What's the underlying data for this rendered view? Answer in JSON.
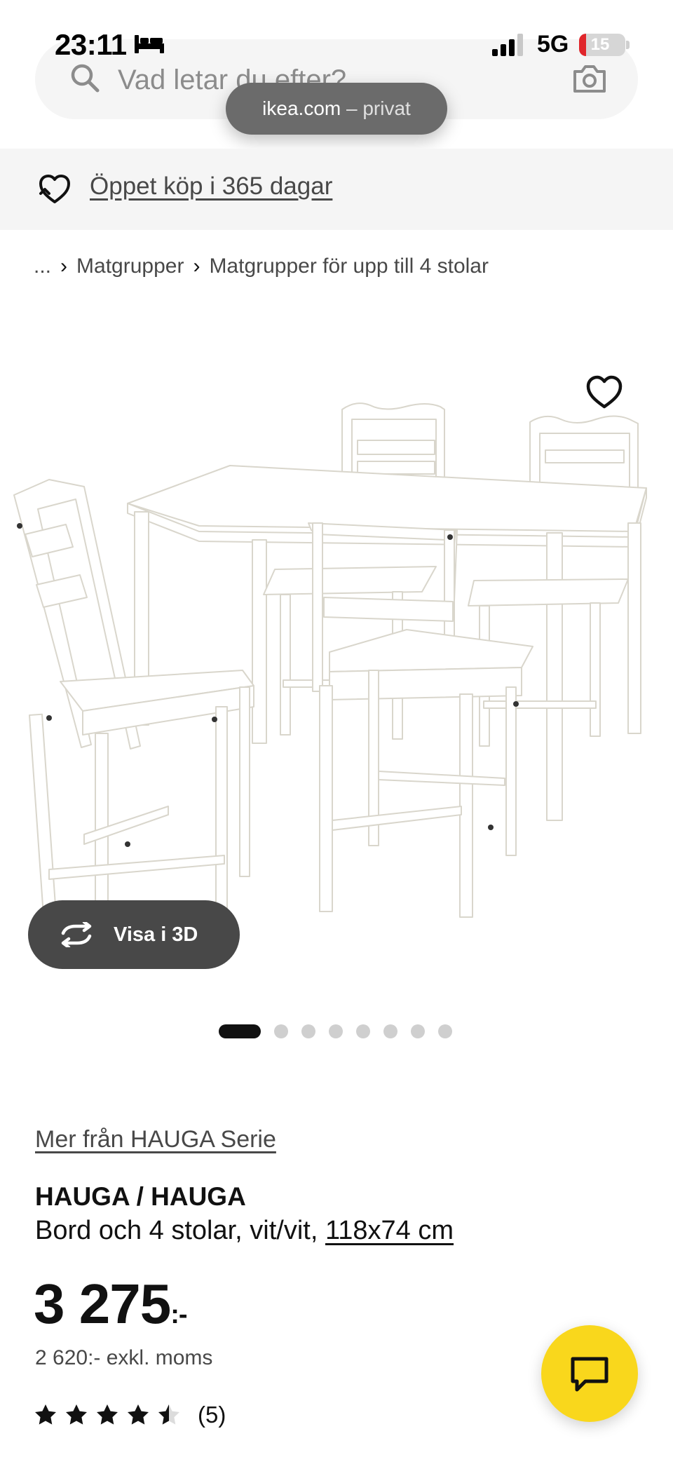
{
  "status_bar": {
    "time": "23:11",
    "network": "5G",
    "battery": "15",
    "battery_level": 0.15,
    "icons": [
      "bed-icon",
      "signal-icon",
      "battery-icon"
    ]
  },
  "search": {
    "placeholder": "Vad letar du efter?",
    "icons": [
      "search-icon",
      "camera-icon"
    ]
  },
  "browser": {
    "domain": "ikea.com",
    "mode": " – privat"
  },
  "banner": {
    "text": "Öppet köp i 365 dagar",
    "icon": "return-heart-icon"
  },
  "breadcrumb": {
    "items": [
      "...",
      "Matgrupper",
      "Matgrupper för upp till 4 stolar"
    ]
  },
  "gallery": {
    "view_3d_label": "Visa i 3D",
    "slide_count": 8,
    "active_slide": 1
  },
  "product": {
    "series_link": "Mer från HAUGA Serie",
    "name": "HAUGA / HAUGA",
    "description": "Bord och 4 stolar, vit/vit, ",
    "size": "118x74 cm",
    "price": "3 275",
    "price_suffix": ":-",
    "price_ex_vat": "2 620:- exkl. moms",
    "rating": 4.5,
    "rating_count": "(5)"
  },
  "colors": {
    "chat_button": "#f9d71c",
    "dark_button": "#484848",
    "text": "#111111",
    "muted_text": "#484848",
    "banner_bg": "#f5f5f5"
  }
}
